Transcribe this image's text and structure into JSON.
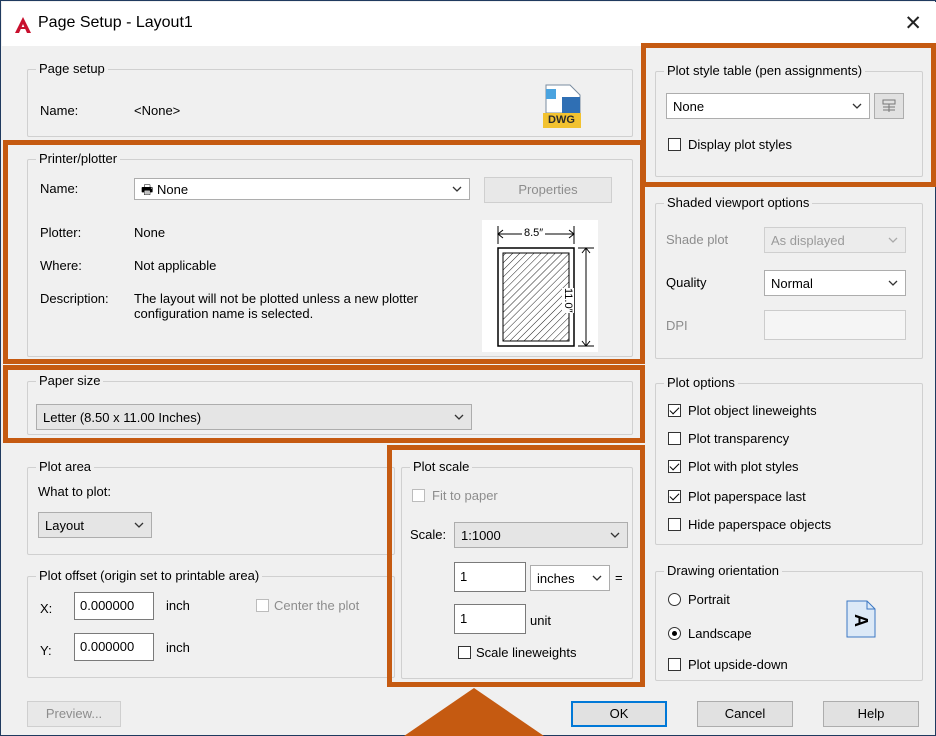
{
  "window": {
    "title": "Page Setup - Layout1"
  },
  "page_setup": {
    "legend": "Page setup",
    "name_label": "Name:",
    "name_value": "<None>",
    "icon_text": "DWG"
  },
  "printer": {
    "legend": "Printer/plotter",
    "name_label": "Name:",
    "name_value": "None",
    "properties_label": "Properties",
    "plotter_label": "Plotter:",
    "plotter_value": "None",
    "where_label": "Where:",
    "where_value": "Not applicable",
    "description_label": "Description:",
    "description_line1": "The layout will not be plotted unless a new plotter",
    "description_line2": "configuration name is selected.",
    "preview_width": "8.5″",
    "preview_height": "11.0″"
  },
  "paper_size": {
    "legend": "Paper size",
    "value": "Letter (8.50 x 11.00 Inches)"
  },
  "plot_area": {
    "legend": "Plot area",
    "what_label": "What to plot:",
    "what_value": "Layout"
  },
  "plot_offset": {
    "legend": "Plot offset (origin set to printable area)",
    "x_label": "X:",
    "x_value": "0.000000",
    "x_unit": "inch",
    "y_label": "Y:",
    "y_value": "0.000000",
    "y_unit": "inch",
    "center_label": "Center the plot"
  },
  "plot_scale": {
    "legend": "Plot scale",
    "fit_label": "Fit to paper",
    "scale_label": "Scale:",
    "scale_value": "1:1000",
    "inches_value": "1",
    "inches_unit": "inches",
    "equals": "=",
    "unit_value": "1",
    "unit_label": "unit",
    "lineweights_label": "Scale lineweights"
  },
  "plot_style_table": {
    "legend": "Plot style table (pen assignments)",
    "value": "None",
    "display_label": "Display plot styles"
  },
  "shaded_viewport": {
    "legend": "Shaded viewport options",
    "shade_label": "Shade plot",
    "shade_value": "As displayed",
    "quality_label": "Quality",
    "quality_value": "Normal",
    "dpi_label": "DPI"
  },
  "plot_options": {
    "legend": "Plot options",
    "items": [
      {
        "label": "Plot object lineweights",
        "checked": true
      },
      {
        "label": "Plot transparency",
        "checked": false
      },
      {
        "label": "Plot with plot styles",
        "checked": true
      },
      {
        "label": "Plot paperspace last",
        "checked": true
      },
      {
        "label": "Hide paperspace objects",
        "checked": false
      }
    ]
  },
  "orientation": {
    "legend": "Drawing orientation",
    "portrait_label": "Portrait",
    "landscape_label": "Landscape",
    "upside_label": "Plot upside-down",
    "icon_letter": "A"
  },
  "footer": {
    "preview_label": "Preview...",
    "ok_label": "OK",
    "cancel_label": "Cancel",
    "help_label": "Help"
  },
  "colors": {
    "highlight": "#c55a11",
    "accent": "#0078d7",
    "app_icon": "#c8102e"
  }
}
